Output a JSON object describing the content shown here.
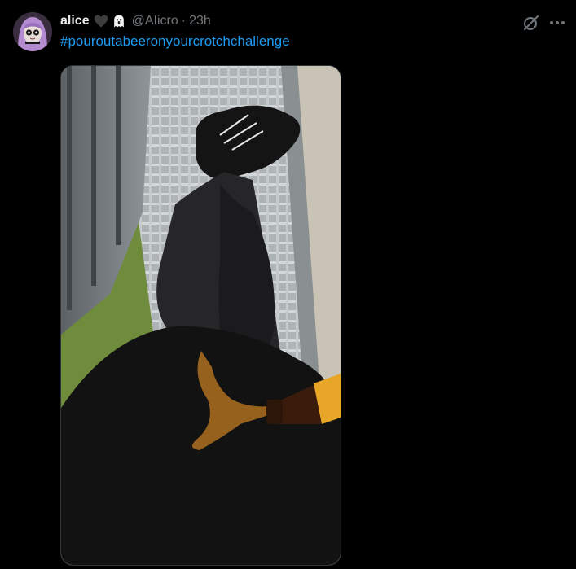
{
  "tweet": {
    "author_name": "alice",
    "emoji": [
      "black-heart-icon",
      "ghost-icon"
    ],
    "handle": "@AIicro",
    "separator": "·",
    "timestamp": "23h",
    "hashtag": "#pouroutabeeronyourcrotchchallenge"
  },
  "actions": {
    "grok_icon": "grok-icon",
    "more_icon": "more-horizontal-icon"
  },
  "media": {
    "type": "photo"
  },
  "colors": {
    "background": "#000000",
    "text": "#e7e9ea",
    "secondary": "#71767b",
    "link": "#1d9bf0",
    "border": "#2f3336"
  }
}
